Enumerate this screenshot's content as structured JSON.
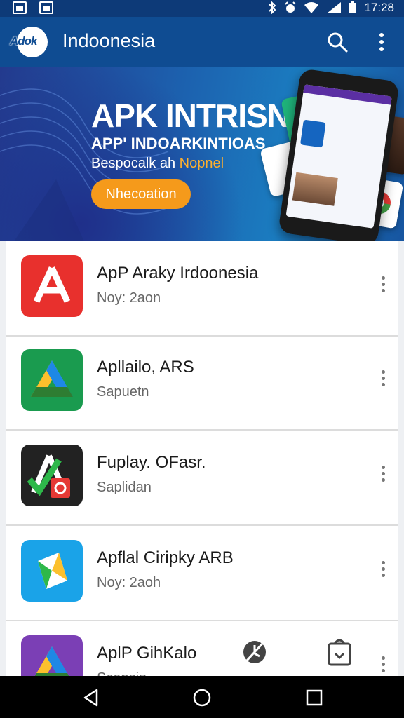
{
  "status_bar": {
    "time": "17:28"
  },
  "app_bar": {
    "logo_text": "Adok",
    "title": "Indoonesia",
    "icons": [
      "search-icon",
      "more-vert-icon"
    ]
  },
  "banner": {
    "headline": "APK INTRISN",
    "subheadline": "APP' INDOARKINTIOAS",
    "tagline_prefix": "Bespocalk ah ",
    "tagline_accent": "Nopnel",
    "button_label": "Nhecoation"
  },
  "apps": [
    {
      "name": "ApP Araky Irdoonesia",
      "subtitle": "Noy: 2aon",
      "icon": "red-a-app-icon"
    },
    {
      "name": "Apllailo, ARS",
      "subtitle": "Sapuetn",
      "icon": "green-drive-app-icon"
    },
    {
      "name": "Fuplay. OFasr.",
      "subtitle": "Saplidan",
      "icon": "dark-a-app-icon"
    },
    {
      "name": "Apflal Ciripky ARB",
      "subtitle": "Noy: 2aoh",
      "icon": "blue-paper-app-icon"
    },
    {
      "name": "AplP GihKalo",
      "subtitle": "Scapsin",
      "icon": "purple-drive-app-icon"
    }
  ],
  "colors": {
    "status_bar": "#0d3a78",
    "app_bar": "#0f4c92",
    "accent": "#f59a1b",
    "nav_bar": "#000000"
  }
}
